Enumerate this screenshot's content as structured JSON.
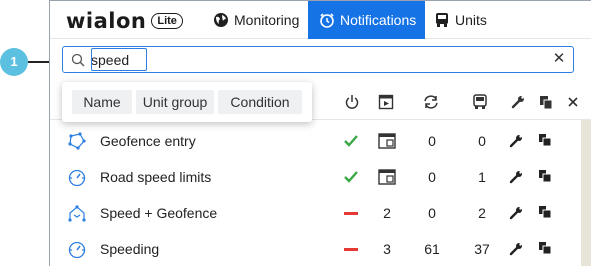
{
  "brand": {
    "name": "wialon",
    "badge": "Lite"
  },
  "nav": {
    "tabs": [
      {
        "label": "Monitoring",
        "icon": "globe-icon",
        "active": false
      },
      {
        "label": "Notifications",
        "icon": "alarm-clock-icon",
        "active": true
      },
      {
        "label": "Units",
        "icon": "truck-icon",
        "active": false
      }
    ],
    "active_color": "#1673e6"
  },
  "search": {
    "value": "speed",
    "placeholder": ""
  },
  "callout": {
    "number": "1"
  },
  "filter": {
    "options": [
      "Name",
      "Unit group",
      "Condition"
    ]
  },
  "header_icons": [
    "power-icon",
    "play-square-icon",
    "refresh-icon",
    "truck-icon",
    "wrench-icon",
    "copy-icon",
    "close-icon"
  ],
  "rows": [
    {
      "name": "Geofence entry",
      "icon": "geofence-icon",
      "state": "on",
      "col2": "",
      "col3": "0",
      "col4": "0"
    },
    {
      "name": "Road speed limits",
      "icon": "speedometer-icon",
      "state": "on",
      "col2": "",
      "col3": "0",
      "col4": "1"
    },
    {
      "name": "Speed + Geofence",
      "icon": "speed-geofence-icon",
      "state": "off",
      "col2": "2",
      "col3": "0",
      "col4": "2"
    },
    {
      "name": "Speeding",
      "icon": "speedometer-icon",
      "state": "off",
      "col2": "3",
      "col3": "61",
      "col4": "37"
    }
  ],
  "colors": {
    "on": "#3aa845",
    "off": "#e53935",
    "accent": "#1673e6",
    "icon_blue": "#2d7fe0"
  }
}
